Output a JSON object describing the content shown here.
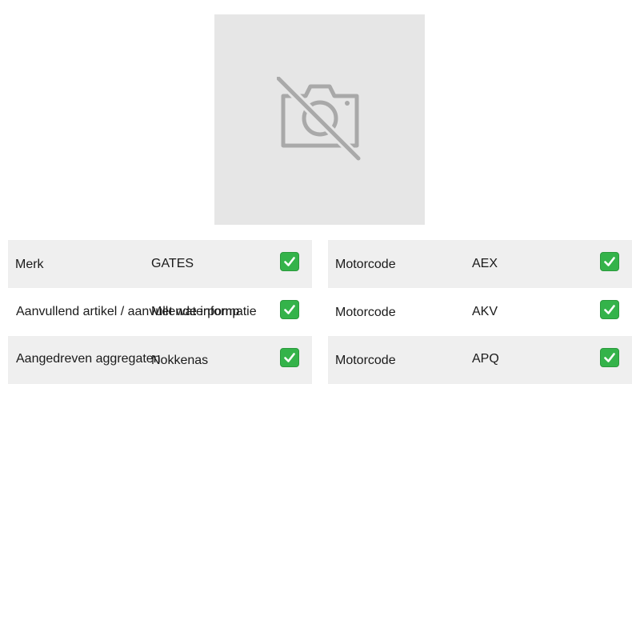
{
  "product_image": {
    "icon": "camera-off-icon"
  },
  "left_table": {
    "rows": [
      {
        "label": "Merk",
        "value": "GATES",
        "status_icon": "check-box-icon"
      },
      {
        "label": "Aanvullend artikel / aanvullende informatie",
        "value": "Met waterpomp",
        "status_icon": "check-box-icon"
      },
      {
        "label": "Aangedreven aggregaten",
        "value": "Nokkenas",
        "status_icon": "check-box-icon"
      }
    ]
  },
  "right_table": {
    "rows": [
      {
        "label": "Motorcode",
        "value": "AEX",
        "status_icon": "check-box-icon"
      },
      {
        "label": "Motorcode",
        "value": "AKV",
        "status_icon": "check-box-icon"
      },
      {
        "label": "Motorcode",
        "value": "APQ",
        "status_icon": "check-box-icon"
      }
    ]
  },
  "colors": {
    "placeholder_bg": "#e6e6e6",
    "placeholder_icon": "#a9a9a9",
    "row_shade": "#efefef",
    "check_green": "#34b34a"
  }
}
